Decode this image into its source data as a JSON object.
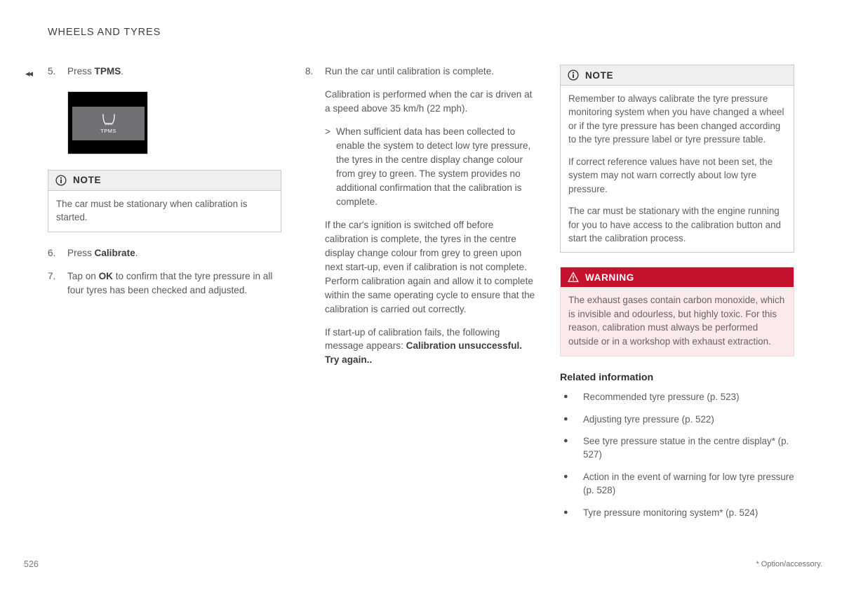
{
  "header": {
    "running_head": "WHEELS AND TYRES"
  },
  "nav": {
    "back_marker": "◂◂"
  },
  "left_column": {
    "step5": {
      "number": "5.",
      "text_prefix": "Press ",
      "bold": "TPMS",
      "text_suffix": "."
    },
    "tpms_figure": {
      "icon_name": "tyre-pressure-icon",
      "label": "TPMS"
    },
    "note": {
      "icon_name": "info-icon",
      "title": "NOTE",
      "paragraphs": [
        "The car must be stationary when calibration is started."
      ]
    },
    "step6": {
      "number": "6.",
      "text_prefix": "Press ",
      "bold": "Calibrate",
      "text_suffix": "."
    },
    "step7": {
      "number": "7.",
      "text_prefix": "Tap on ",
      "bold": "OK",
      "text_suffix": " to confirm that the tyre pressure in all four tyres has been checked and adjusted."
    }
  },
  "middle_column": {
    "step8": {
      "number": "8.",
      "text": "Run the car until calibration is complete."
    },
    "para1": "Calibration is performed when the car is driven at a speed above 35 km/h (22 mph).",
    "sub_item": {
      "marker": ">",
      "text": "When sufficient data has been collected to enable the system to detect low tyre pressure, the tyres in the centre display change colour from grey to green. The system provides no additional confirmation that the calibration is complete."
    },
    "para2": "If the car's ignition is switched off before calibration is complete, the tyres in the centre display change colour from grey to green upon next start-up, even if calibration is not complete. Perform calibration again and allow it to complete within the same operating cycle to ensure that the calibration is carried out correctly.",
    "para3_prefix": "If start-up of calibration fails, the following message appears: ",
    "para3_bold": "Calibration unsuccessful. Try again.."
  },
  "right_column": {
    "note": {
      "icon_name": "info-icon",
      "title": "NOTE",
      "paragraphs": [
        "Remember to always calibrate the tyre pressure monitoring system when you have changed a wheel or if the tyre pressure has been changed according to the tyre pressure label or tyre pressure table.",
        "If correct reference values have not been set, the system may not warn correctly about low tyre pressure.",
        "The car must be stationary with the engine running for you to have access to the calibration button and start the calibration process."
      ]
    },
    "warning": {
      "icon_name": "warning-triangle-icon",
      "title": "WARNING",
      "body": "The exhaust gases contain carbon monoxide, which is invisible and odourless, but highly toxic. For this reason, calibration must always be performed outside or in a workshop with exhaust extraction."
    },
    "related": {
      "title": "Related information",
      "items": [
        "Recommended tyre pressure (p. 523)",
        "Adjusting tyre pressure (p. 522)",
        "See tyre pressure statue in the centre display* (p. 527)",
        "Action in the event of warning for low tyre pressure (p. 528)",
        "Tyre pressure monitoring system* (p. 524)"
      ],
      "bullet": "●"
    }
  },
  "footer": {
    "page_number": "526",
    "footnote": "* Option/accessory."
  },
  "colors": {
    "warning_red": "#c4122f",
    "warning_bg": "#fbeaea",
    "note_header_bg": "#efefef",
    "body_text": "#58595b"
  }
}
